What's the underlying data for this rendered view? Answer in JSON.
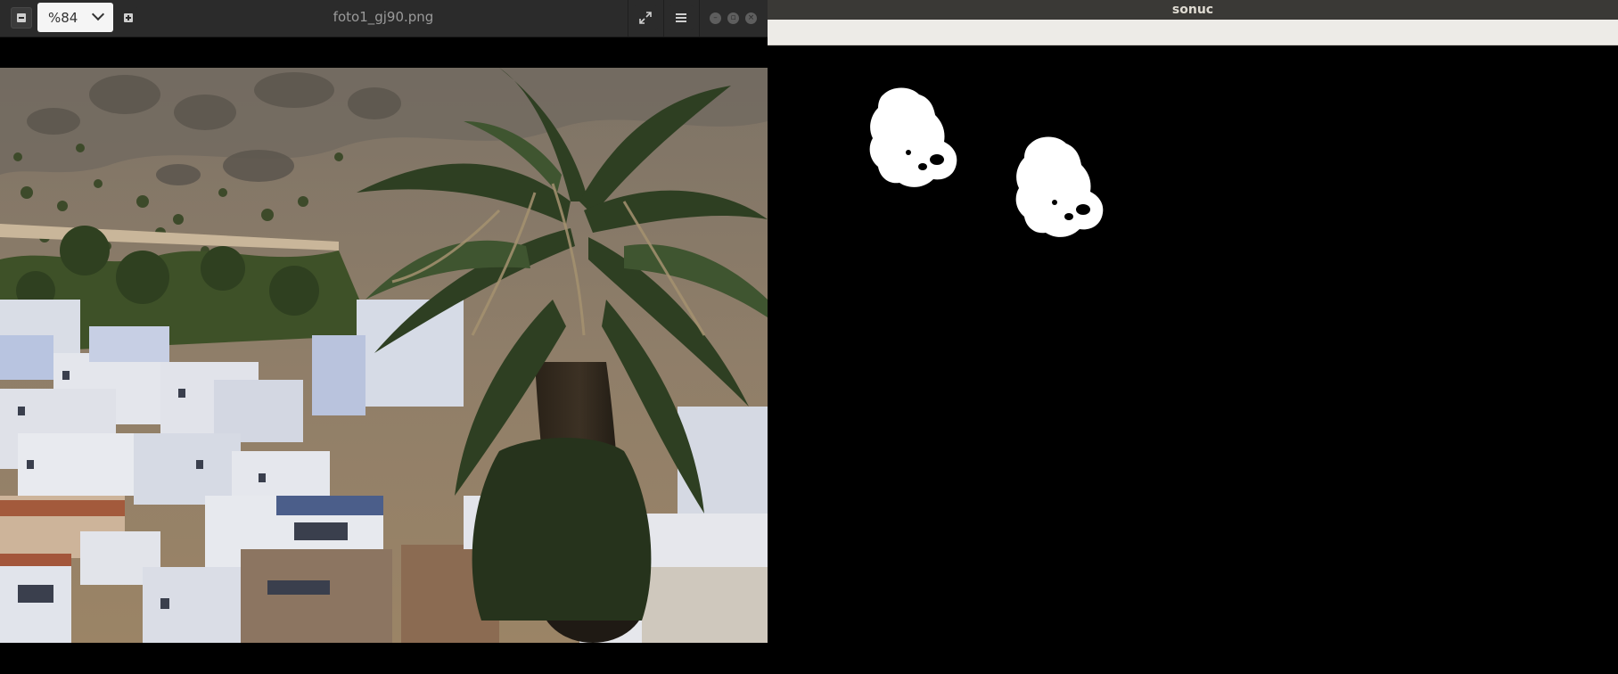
{
  "viewer": {
    "zoom_value": "%84",
    "file_title": "foto1_gj90.png",
    "zoom_out_icon": "zoom-out-icon",
    "zoom_in_icon": "zoom-in-icon",
    "expand_icon": "expand-icon",
    "menu_icon": "hamburger-menu-icon",
    "window_controls": [
      "minimize",
      "maximize",
      "close"
    ]
  },
  "mask_window": {
    "title": "sonuc"
  },
  "colors": {
    "viewer_header": "#2b2b2b",
    "mask_titlebar": "#3a3936",
    "mask_toolbar": "#edebe7",
    "canvas": "#000000",
    "blob": "#ffffff"
  }
}
